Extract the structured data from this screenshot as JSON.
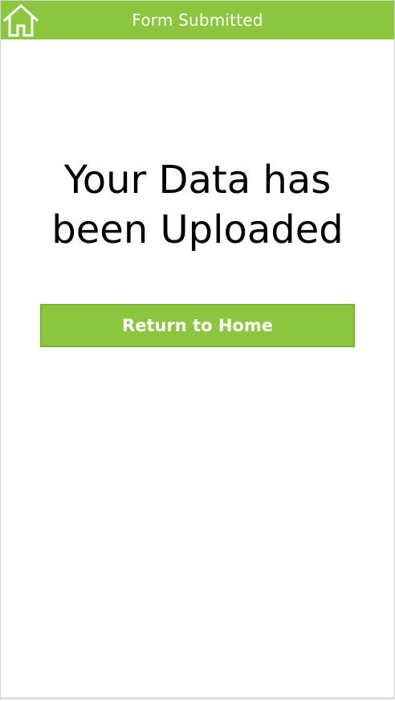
{
  "header": {
    "title": "Form Submitted",
    "home_icon": "home-icon"
  },
  "main": {
    "message": "Your Data has been Uploaded",
    "return_button_label": "Return to Home"
  },
  "colors": {
    "accent": "#8cc63f",
    "accent_border": "#7ab235",
    "text": "#000000",
    "header_text": "#ffffff"
  }
}
